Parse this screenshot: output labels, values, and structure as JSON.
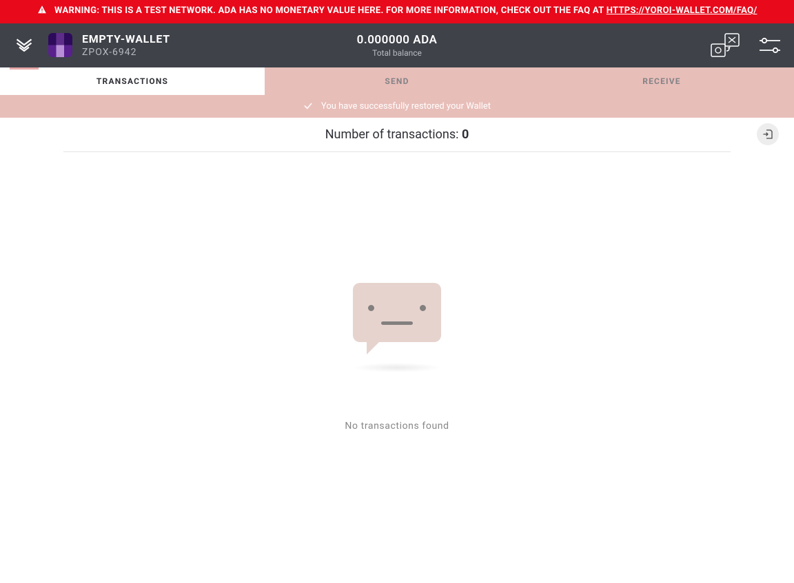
{
  "warning": {
    "prefix": "WARNING: THIS IS A TEST NETWORK. ADA HAS NO MONETARY VALUE HERE. FOR MORE INFORMATION, CHECK OUT THE FAQ AT ",
    "link_text": "HTTPS://YOROI-WALLET.COM/FAQ/"
  },
  "header": {
    "wallet_name": "EMPTY-WALLET",
    "wallet_code": "ZPOX-6942",
    "balance_amount": "0.000000 ADA",
    "balance_label": "Total balance"
  },
  "tabs": {
    "transactions": "TRANSACTIONS",
    "send": "SEND",
    "receive": "RECEIVE"
  },
  "notice": {
    "text": "You have successfully restored your Wallet"
  },
  "summary": {
    "label": "Number of transactions: ",
    "count": "0"
  },
  "empty": {
    "text": "No transactions found"
  }
}
